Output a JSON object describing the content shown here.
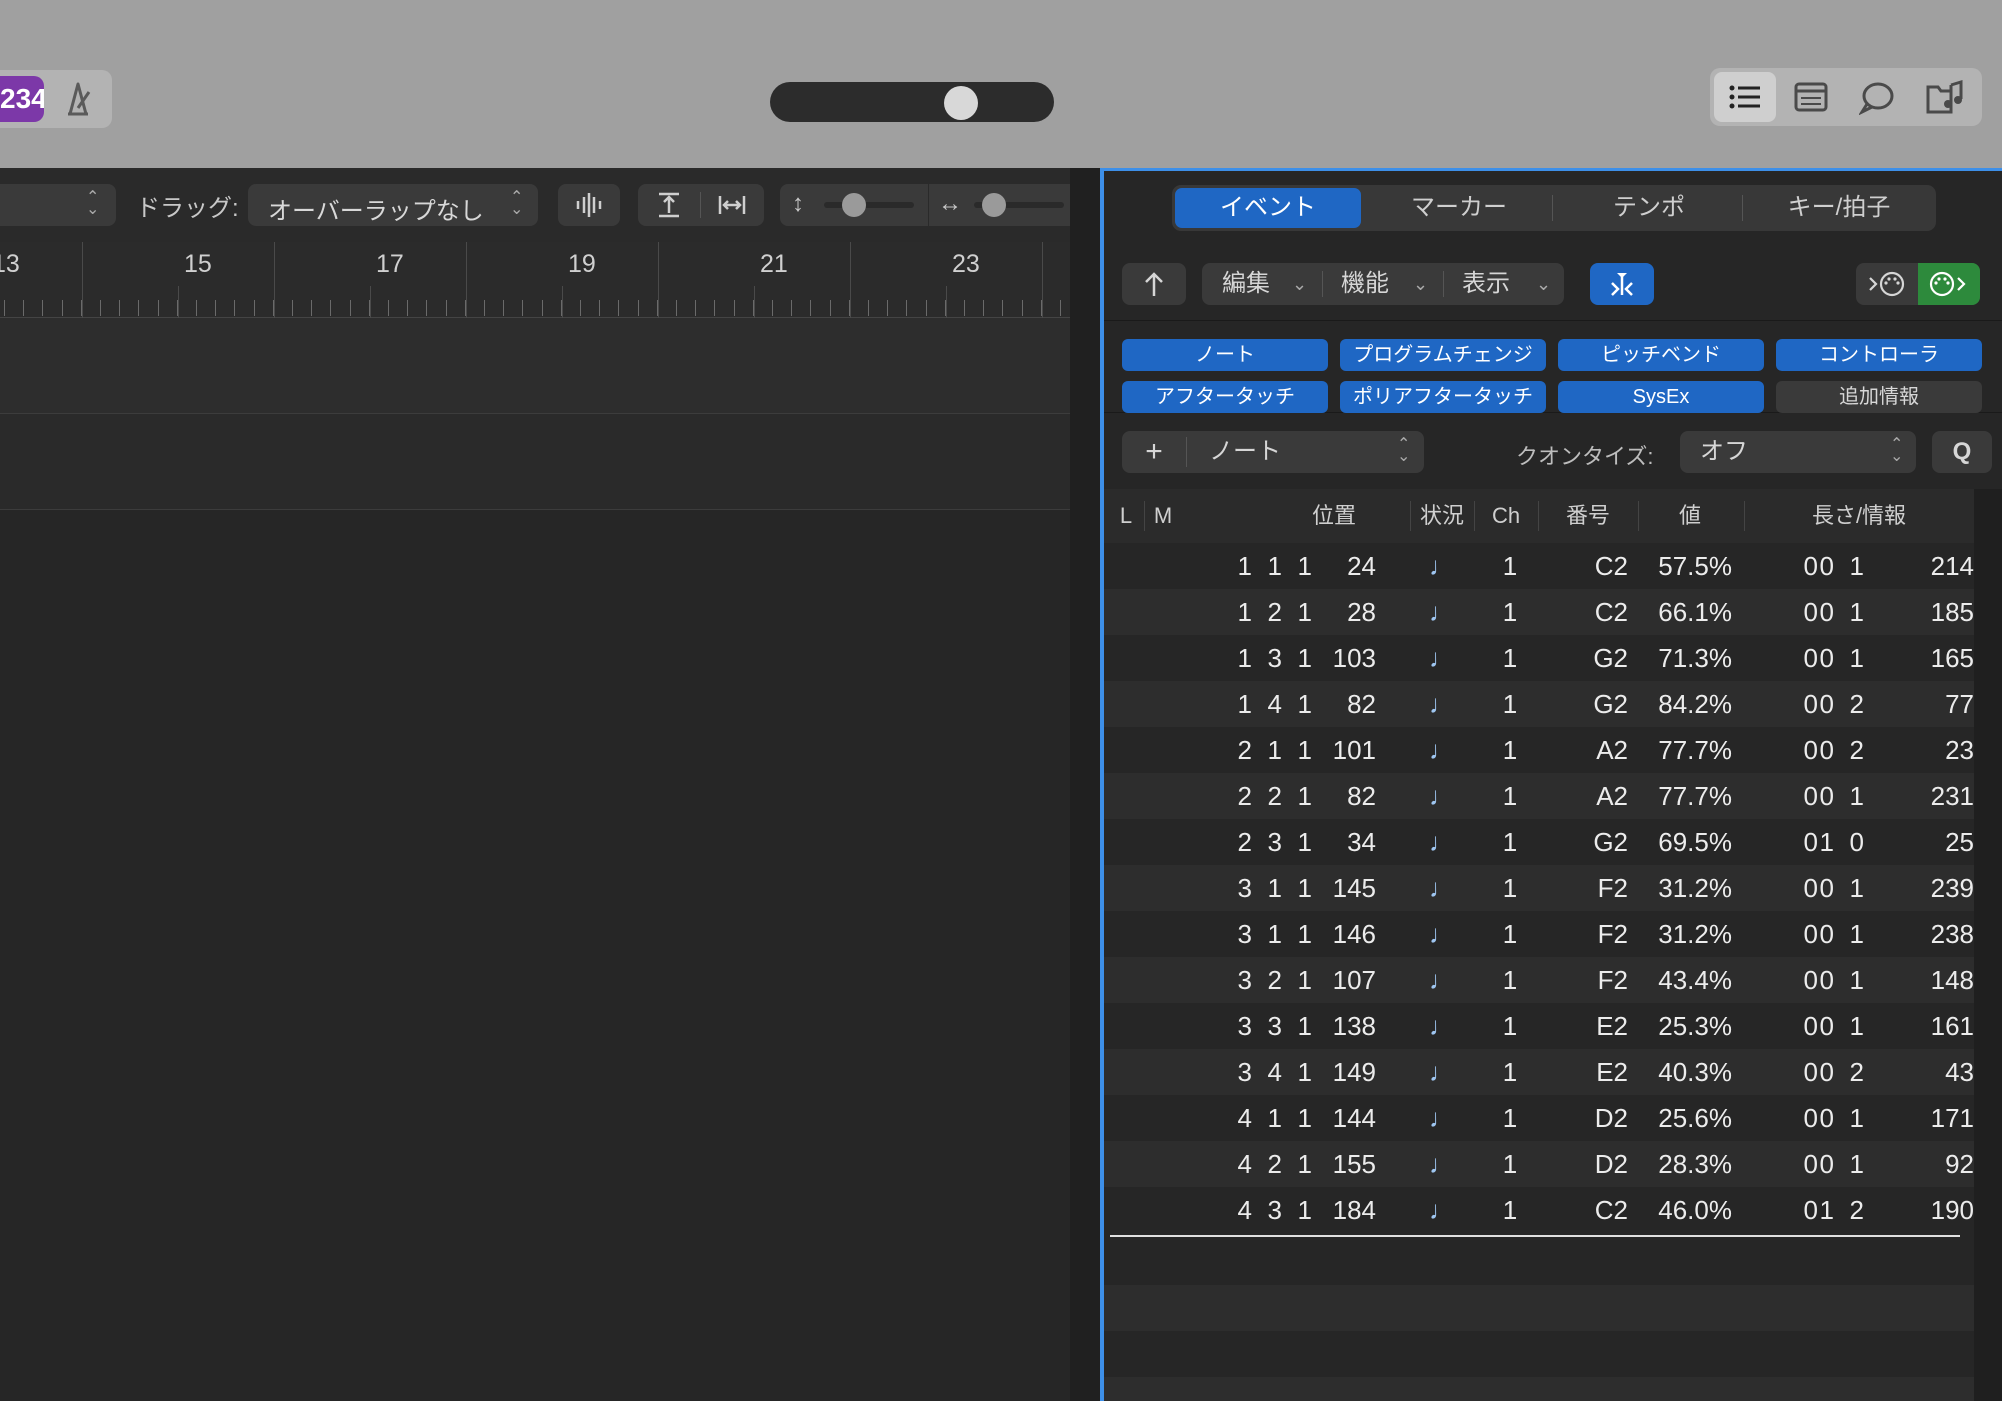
{
  "topbar": {
    "lcd_value": "234",
    "view_buttons": [
      "list-view-icon",
      "editor-view-icon",
      "chat-icon",
      "browser-icon"
    ]
  },
  "tracks": {
    "toolbar": {
      "drag_label": "ドラッグ:",
      "drag_value": "オーバーラップなし"
    },
    "ruler_bars": [
      "13",
      "15",
      "17",
      "19",
      "21",
      "23"
    ]
  },
  "event_list": {
    "tabs": [
      "イベント",
      "マーカー",
      "テンポ",
      "キー/拍子"
    ],
    "active_tab": 0,
    "menus": {
      "edit": "編集",
      "functions": "機能",
      "view": "表示"
    },
    "filters": [
      {
        "label": "ノート",
        "on": true
      },
      {
        "label": "プログラムチェンジ",
        "on": true
      },
      {
        "label": "ピッチベンド",
        "on": true
      },
      {
        "label": "コントローラ",
        "on": true
      },
      {
        "label": "アフタータッチ",
        "on": true
      },
      {
        "label": "ポリアフタータッチ",
        "on": true
      },
      {
        "label": "SysEx",
        "on": true
      },
      {
        "label": "追加情報",
        "on": false
      }
    ],
    "create": {
      "plus": "+",
      "type": "ノート",
      "quantize_label": "クオンタイズ:",
      "quantize_value": "オフ",
      "q_button": "Q"
    },
    "columns": [
      "L",
      "M",
      "位置",
      "状況",
      "Ch",
      "番号",
      "値",
      "長さ/情報"
    ],
    "rows": [
      {
        "pos": [
          "1",
          "1",
          "1",
          "24"
        ],
        "status": "♩",
        "ch": "1",
        "num": "C2",
        "val": "57.5%",
        "len": [
          "0",
          "0",
          "1",
          "214"
        ]
      },
      {
        "pos": [
          "1",
          "2",
          "1",
          "28"
        ],
        "status": "♩",
        "ch": "1",
        "num": "C2",
        "val": "66.1%",
        "len": [
          "0",
          "0",
          "1",
          "185"
        ]
      },
      {
        "pos": [
          "1",
          "3",
          "1",
          "103"
        ],
        "status": "♩",
        "ch": "1",
        "num": "G2",
        "val": "71.3%",
        "len": [
          "0",
          "0",
          "1",
          "165"
        ]
      },
      {
        "pos": [
          "1",
          "4",
          "1",
          "82"
        ],
        "status": "♩",
        "ch": "1",
        "num": "G2",
        "val": "84.2%",
        "len": [
          "0",
          "0",
          "2",
          "77"
        ]
      },
      {
        "pos": [
          "2",
          "1",
          "1",
          "101"
        ],
        "status": "♩",
        "ch": "1",
        "num": "A2",
        "val": "77.7%",
        "len": [
          "0",
          "0",
          "2",
          "23"
        ]
      },
      {
        "pos": [
          "2",
          "2",
          "1",
          "82"
        ],
        "status": "♩",
        "ch": "1",
        "num": "A2",
        "val": "77.7%",
        "len": [
          "0",
          "0",
          "1",
          "231"
        ]
      },
      {
        "pos": [
          "2",
          "3",
          "1",
          "34"
        ],
        "status": "♩",
        "ch": "1",
        "num": "G2",
        "val": "69.5%",
        "len": [
          "0",
          "1",
          "0",
          "25"
        ]
      },
      {
        "pos": [
          "3",
          "1",
          "1",
          "145"
        ],
        "status": "♩",
        "ch": "1",
        "num": "F2",
        "val": "31.2%",
        "len": [
          "0",
          "0",
          "1",
          "239"
        ]
      },
      {
        "pos": [
          "3",
          "1",
          "1",
          "146"
        ],
        "status": "♩",
        "ch": "1",
        "num": "F2",
        "val": "31.2%",
        "len": [
          "0",
          "0",
          "1",
          "238"
        ]
      },
      {
        "pos": [
          "3",
          "2",
          "1",
          "107"
        ],
        "status": "♩",
        "ch": "1",
        "num": "F2",
        "val": "43.4%",
        "len": [
          "0",
          "0",
          "1",
          "148"
        ]
      },
      {
        "pos": [
          "3",
          "3",
          "1",
          "138"
        ],
        "status": "♩",
        "ch": "1",
        "num": "E2",
        "val": "25.3%",
        "len": [
          "0",
          "0",
          "1",
          "161"
        ]
      },
      {
        "pos": [
          "3",
          "4",
          "1",
          "149"
        ],
        "status": "♩",
        "ch": "1",
        "num": "E2",
        "val": "40.3%",
        "len": [
          "0",
          "0",
          "2",
          "43"
        ]
      },
      {
        "pos": [
          "4",
          "1",
          "1",
          "144"
        ],
        "status": "♩",
        "ch": "1",
        "num": "D2",
        "val": "25.6%",
        "len": [
          "0",
          "0",
          "1",
          "171"
        ]
      },
      {
        "pos": [
          "4",
          "2",
          "1",
          "155"
        ],
        "status": "♩",
        "ch": "1",
        "num": "D2",
        "val": "28.3%",
        "len": [
          "0",
          "0",
          "1",
          "92"
        ]
      },
      {
        "pos": [
          "4",
          "3",
          "1",
          "184"
        ],
        "status": "♩",
        "ch": "1",
        "num": "C2",
        "val": "46.0%",
        "len": [
          "0",
          "1",
          "2",
          "190"
        ]
      }
    ]
  },
  "colors": {
    "accent_blue": "#1f67c4",
    "focus_border": "#3d8fe8",
    "lcd_purple": "#7c38a8",
    "midi_green": "#2d8a3c"
  }
}
